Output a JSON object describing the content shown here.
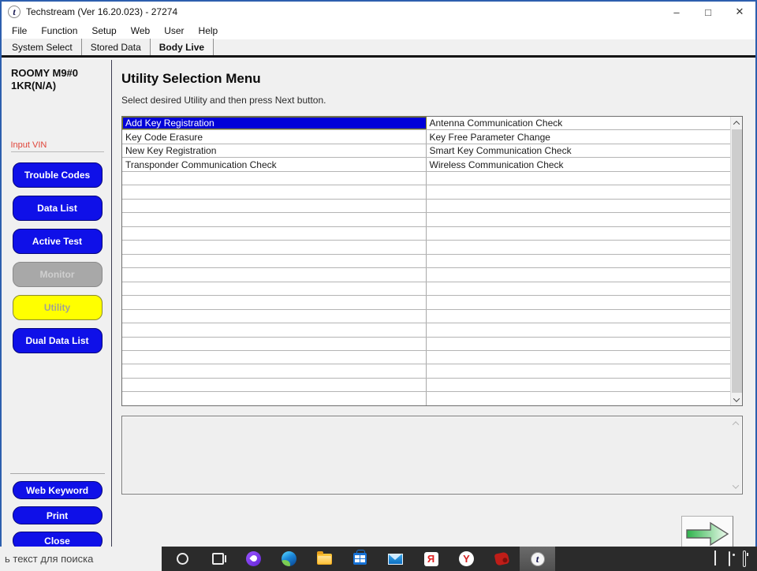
{
  "window": {
    "title": "Techstream (Ver 16.20.023) - 27274",
    "logo_glyph": "t",
    "controls": {
      "minimize": "–",
      "maximize": "□",
      "close": "✕"
    }
  },
  "menu": {
    "items": [
      "File",
      "Function",
      "Setup",
      "Web",
      "User",
      "Help"
    ]
  },
  "tabs": {
    "items": [
      {
        "label": "System Select",
        "active": false
      },
      {
        "label": "Stored Data",
        "active": false
      },
      {
        "label": "Body Live",
        "active": true
      }
    ]
  },
  "sidebar": {
    "vehicle_model": "ROOMY M9#0",
    "vehicle_engine": "1KR(N/A)",
    "input_vin_label": "Input VIN",
    "buttons": [
      {
        "label": "Trouble Codes",
        "style": "blue"
      },
      {
        "label": "Data List",
        "style": "blue"
      },
      {
        "label": "Active Test",
        "style": "blue"
      },
      {
        "label": "Monitor",
        "style": "disabled"
      },
      {
        "label": "Utility",
        "style": "active"
      },
      {
        "label": "Dual Data List",
        "style": "blue"
      }
    ],
    "footer_buttons": [
      {
        "label": "Web Keyword"
      },
      {
        "label": "Print"
      },
      {
        "label": "Close"
      }
    ]
  },
  "main": {
    "title": "Utility Selection Menu",
    "subtitle": "Select desired Utility and then press Next button.",
    "utility_table": {
      "selected": "Add Key Registration",
      "row_count": 21,
      "left_column": [
        "Add Key Registration",
        "Key Code Erasure",
        "New Key Registration",
        "Transponder Communication Check"
      ],
      "right_column": [
        "Antenna Communication Check",
        "Key Free Parameter Change",
        "Smart Key Communication Check",
        "Wireless Communication Check"
      ]
    }
  },
  "taskbar": {
    "search_text": "ь текст для поиска",
    "icons": [
      {
        "name": "cortana"
      },
      {
        "name": "task-view"
      },
      {
        "name": "alice"
      },
      {
        "name": "edge"
      },
      {
        "name": "file-explorer"
      },
      {
        "name": "store"
      },
      {
        "name": "mail"
      },
      {
        "name": "yandex-app",
        "glyph": "Я"
      },
      {
        "name": "yandex-browser",
        "glyph": "Y"
      },
      {
        "name": "red-tool"
      },
      {
        "name": "techstream",
        "glyph": "t",
        "active": true
      }
    ],
    "tray": [
      {
        "name": "hidden-icons"
      },
      {
        "name": "hardware"
      },
      {
        "name": "battery"
      }
    ]
  },
  "colors": {
    "button_blue": "#0f10e8",
    "button_yellow": "#ffff00",
    "selection_blue": "#0000d8",
    "input_vin_red": "#e04338",
    "next_arrow_green": "#2eb34c",
    "window_border": "#2d5fae"
  }
}
